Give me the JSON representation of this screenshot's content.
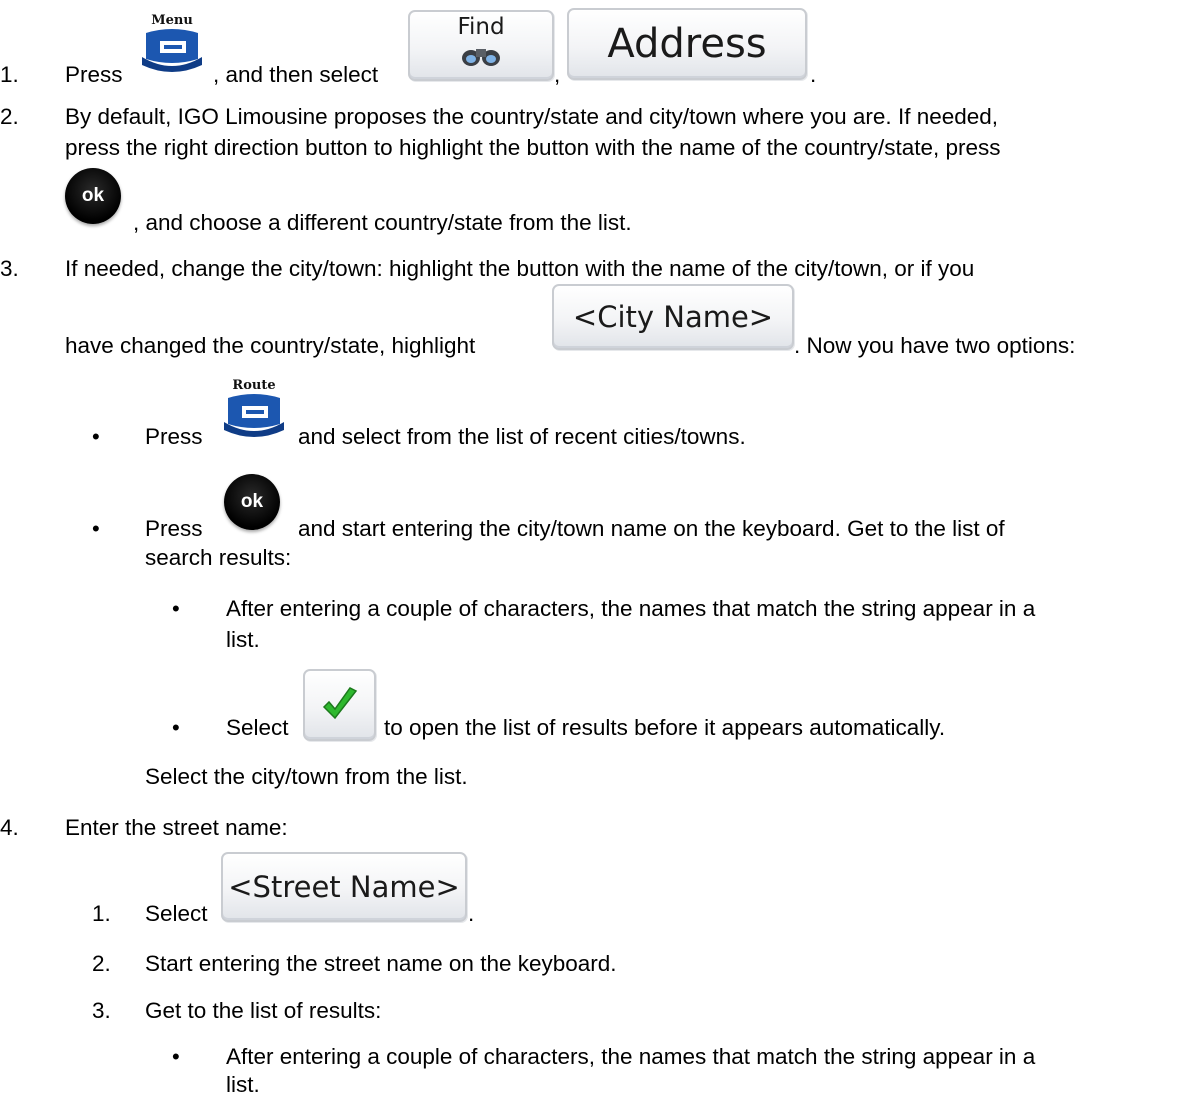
{
  "steps": {
    "s1": {
      "num": "1.",
      "press": "Press",
      "then_select": ", and then select",
      "comma": ",",
      "period": ".",
      "menu_caption": "Menu",
      "find_caption": "Find",
      "address_label": "Address"
    },
    "s2": {
      "num": "2.",
      "line1": "By default, IGO Limousine proposes the country/state and city/town where you are. If needed,",
      "line2": "press the right direction button to highlight the button with the name of the country/state, press",
      "ok_label": "ok",
      "line3": ", and choose a different country/state from the list."
    },
    "s3": {
      "num": "3.",
      "line1": "If needed, change the city/town: highlight the button with the name of the city/town, or if you",
      "line2a": "have changed the country/state, highlight",
      "city_button": "<City Name>",
      "line2b": ". Now you have two options:",
      "b1_press": "Press",
      "route_caption": "Route",
      "b1_text": "and select from the list of recent cities/towns.",
      "b2_press": "Press",
      "ok_label": "ok",
      "b2_text": "and start entering the city/town name on the keyboard. Get to the list of",
      "b2_text2": "search results:",
      "sb1_line1": "After entering a couple of characters, the names that match the string appear in a",
      "sb1_line2": "list.",
      "sb2_select": "Select",
      "sb2_text": "to open the list of results before it appears automatically.",
      "select_city": "Select the city/town from the list."
    },
    "s4": {
      "num": "4.",
      "title": "Enter the street name:",
      "sub1_num": "1.",
      "sub1_select": "Select",
      "street_button": "<Street Name>",
      "period": ".",
      "sub2_num": "2.",
      "sub2_text": "Start entering the street name on the keyboard.",
      "sub3_num": "3.",
      "sub3_text": "Get to the list of results:",
      "sb1_line1": "After entering a couple of characters, the names that match the string appear in a",
      "sb1_line2": "list."
    }
  },
  "bullet_glyph": "•",
  "colors": {
    "icon_blue": "#1c57b0",
    "ok_black": "#000000",
    "check_green": "#2eb82e"
  }
}
